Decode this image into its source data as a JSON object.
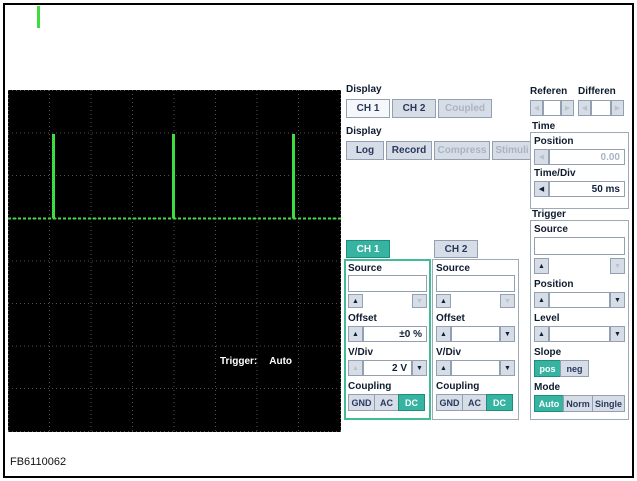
{
  "icons": {
    "left_arrow": "◀",
    "right_arrow": "▶",
    "up_arrow": "▲",
    "down_arrow": "▼"
  },
  "colors": {
    "accent_teal": "#36b4a1",
    "waveform_green": "#3fdc3f"
  },
  "scope": {
    "trigger_label": "Trigger:",
    "trigger_mode": "Auto"
  },
  "display_channels": {
    "label": "Display",
    "buttons": [
      {
        "label": "CH 1"
      },
      {
        "label": "CH 2"
      },
      {
        "label": "Coupled"
      }
    ]
  },
  "display_modes": {
    "label": "Display",
    "buttons": [
      {
        "label": "Log"
      },
      {
        "label": "Record"
      },
      {
        "label": "Compress"
      },
      {
        "label": "Stimuli"
      }
    ]
  },
  "reference": {
    "label": "Referen"
  },
  "differential": {
    "label": "Differen"
  },
  "time": {
    "label": "Time",
    "position": {
      "label": "Position",
      "value": "0.00"
    },
    "time_div": {
      "label": "Time/Div",
      "value": "50 ms"
    }
  },
  "trigger": {
    "label": "Trigger",
    "source_label": "Source",
    "position_label": "Position",
    "level_label": "Level",
    "slope": {
      "label": "Slope",
      "pos": "pos",
      "neg": "neg"
    },
    "mode": {
      "label": "Mode",
      "auto": "Auto",
      "norm": "Norm",
      "single": "Single"
    }
  },
  "ch1": {
    "header": "CH 1",
    "source_label": "Source",
    "offset": {
      "label": "Offset",
      "value": "±0 %"
    },
    "v_div": {
      "label": "V/Div",
      "value": "2 V"
    },
    "coupling": {
      "label": "Coupling",
      "gnd": "GND",
      "ac": "AC",
      "dc": "DC"
    }
  },
  "ch2": {
    "header": "CH 2",
    "source_label": "Source",
    "offset": {
      "label": "Offset",
      "value": ""
    },
    "v_div": {
      "label": "V/Div",
      "value": ""
    },
    "coupling": {
      "label": "Coupling",
      "gnd": "GND",
      "ac": "AC",
      "dc": "DC"
    }
  },
  "footer": {
    "figure_id": "FB6110062"
  }
}
